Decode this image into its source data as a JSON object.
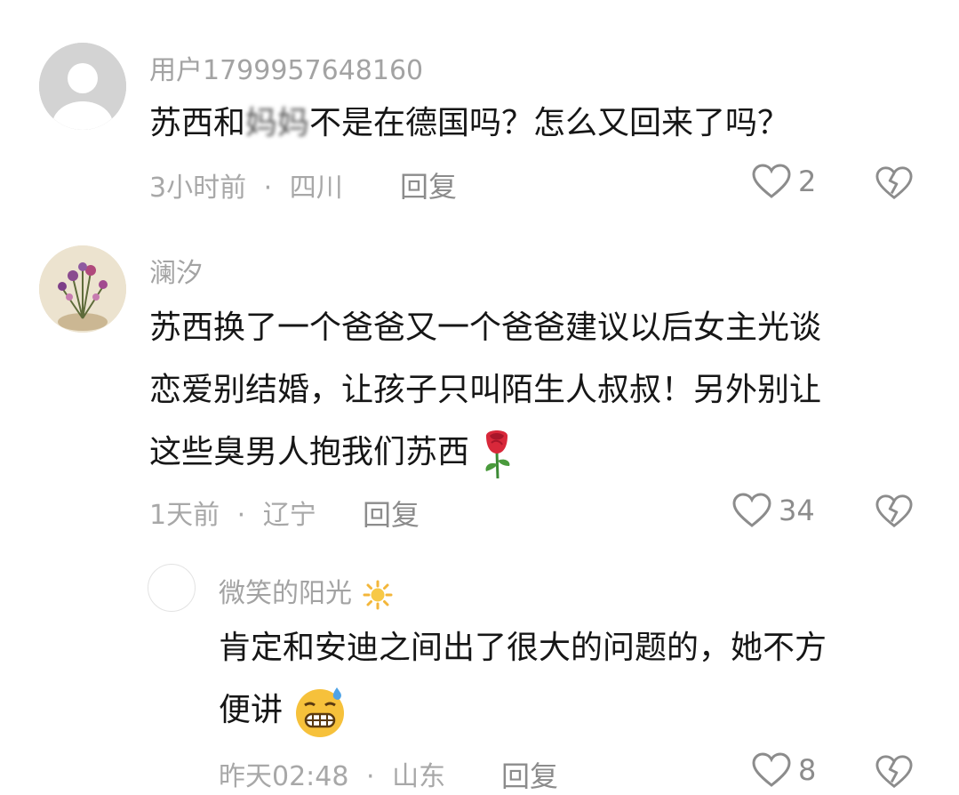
{
  "comments": [
    {
      "username": "用户1799957648160",
      "text_before_blur": "苏西和",
      "text_blurred": "妈妈",
      "text_after_blur": "不是在德国吗？怎么又回来了吗？",
      "time": "3小时前",
      "location": "四川",
      "reply_label": "回复",
      "likes": "2"
    },
    {
      "username": "澜汐",
      "lines": [
        "苏西换了一个爸爸又一个爸爸建议以后女主光谈",
        "恋爱别结婚，让孩子只叫陌生人叔叔！另外别让",
        "这些臭男人抱我们苏西"
      ],
      "emoji": "rose-emoji",
      "time": "1天前",
      "location": "辽宁",
      "reply_label": "回复",
      "likes": "34"
    },
    {
      "username": "微笑的阳光",
      "username_emoji": "sun-emoji",
      "lines": [
        "肯定和安迪之间出了很大的问题的，她不方",
        "便讲"
      ],
      "emoji": "grimacing-sweat-emoji",
      "time": "昨天02:48",
      "location": "山东",
      "reply_label": "回复",
      "likes": "8"
    }
  ],
  "separator": "·"
}
